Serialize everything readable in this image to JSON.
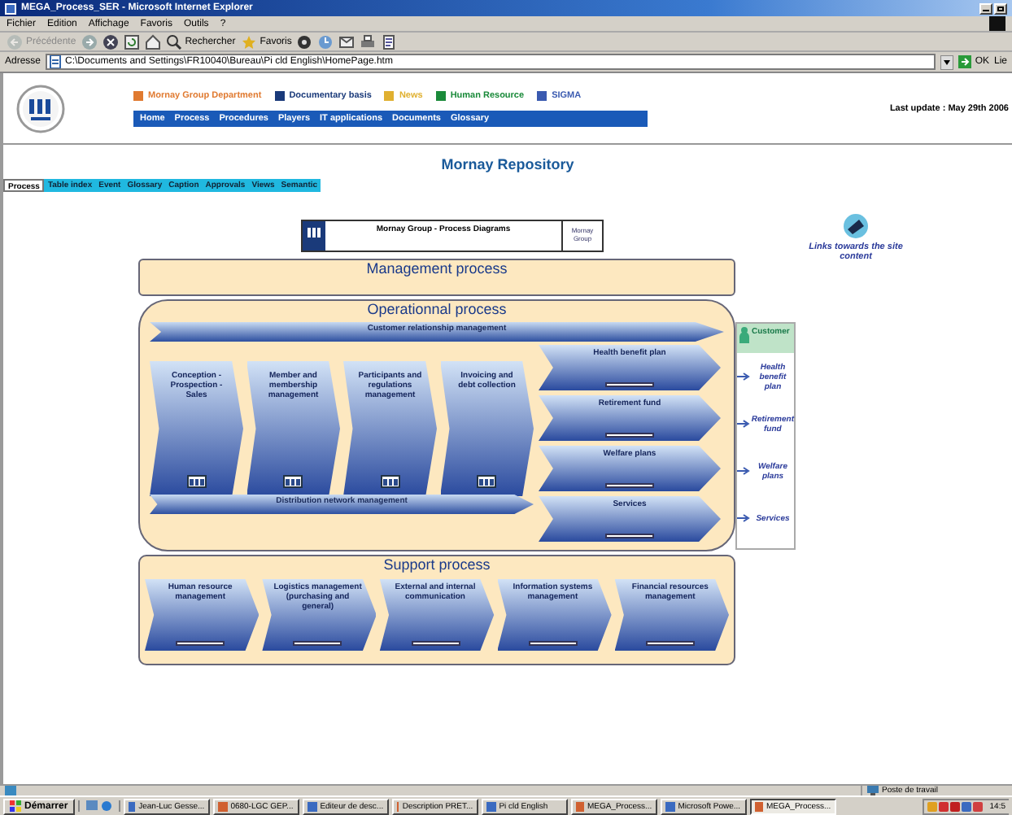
{
  "window": {
    "title": "MEGA_Process_SER - Microsoft Internet Explorer"
  },
  "menu": [
    "Fichier",
    "Edition",
    "Affichage",
    "Favoris",
    "Outils",
    "?"
  ],
  "toolbar": [
    {
      "kind": "back",
      "label": "Précédente",
      "disabled": true
    },
    {
      "kind": "forward",
      "disabled": false
    },
    {
      "kind": "stop",
      "disabled": false
    },
    {
      "kind": "refresh",
      "disabled": false
    },
    {
      "kind": "home",
      "disabled": false
    },
    {
      "kind": "search",
      "label": "Rechercher",
      "disabled": false
    },
    {
      "kind": "favorites",
      "label": "Favoris",
      "disabled": false
    },
    {
      "kind": "media",
      "disabled": false
    },
    {
      "kind": "history",
      "disabled": false
    },
    {
      "kind": "mail",
      "disabled": false
    },
    {
      "kind": "print",
      "disabled": false
    },
    {
      "kind": "edit",
      "disabled": false
    }
  ],
  "address": {
    "label": "Adresse",
    "value": "C:\\Documents and Settings\\FR10040\\Bureau\\Pi cld English\\HomePage.htm",
    "go": "OK",
    "links": "Lie"
  },
  "site_links": [
    {
      "label": "Mornay Group Department",
      "color": "#e07a30"
    },
    {
      "label": "Documentary basis",
      "color": "#1a3a7a"
    },
    {
      "label": "News",
      "color": "#e0b030"
    },
    {
      "label": "Human Resource",
      "color": "#1a8a3a"
    },
    {
      "label": "SIGMA",
      "color": "#3a5ab0"
    }
  ],
  "nav": [
    "Home",
    "Process",
    "Procedures",
    "Players",
    "IT applications",
    "Documents",
    "Glossary"
  ],
  "last_update": "Last update : May 29th 2006",
  "page_title": "Mornay Repository",
  "tabs": [
    {
      "label": "Process",
      "selected": true
    },
    {
      "label": "Table index",
      "selected": false
    },
    {
      "label": "Event",
      "selected": false
    },
    {
      "label": "Glossary",
      "selected": false
    },
    {
      "label": "Caption",
      "selected": false
    },
    {
      "label": "Approvals",
      "selected": false
    },
    {
      "label": "Views",
      "selected": false
    },
    {
      "label": "Semantic",
      "selected": false
    }
  ],
  "diagram": {
    "header": {
      "title": "Mornay Group - Process Diagrams",
      "caption": "Mornay Group"
    },
    "management": {
      "title": "Management process"
    },
    "operational": {
      "title": "Operationnal process",
      "top_flow": "Customer relationship management",
      "steps": [
        "Conception - Prospection - Sales",
        "Member and membership management",
        "Participants and regulations management",
        "Invoicing and debt collection"
      ],
      "bottom_flow": "Distribution network management",
      "products": [
        "Health benefit plan",
        "Retirement fund",
        "Welfare plans",
        "Services"
      ]
    },
    "customer": {
      "title": "Customer",
      "items": [
        "Health benefit plan",
        "Retirement fund",
        "Welfare plans",
        "Services"
      ]
    },
    "support": {
      "title": "Support process",
      "steps": [
        "Human resource management",
        "Logistics management (purchasing and general)",
        "External and internal communication",
        "Information systems management",
        "Financial resources management"
      ]
    }
  },
  "links_panel": {
    "text": "Links towards the site content"
  },
  "status_bar": {
    "zone": "Poste de travail"
  },
  "taskbar": {
    "start": "Démarrer",
    "items": [
      {
        "label": "Jean-Luc Gesse...",
        "selected": false
      },
      {
        "label": "0680-LGC GEP...",
        "selected": false
      },
      {
        "label": "Editeur de desc...",
        "selected": false
      },
      {
        "label": "Description PRET...",
        "selected": false
      },
      {
        "label": "Pi cld English",
        "selected": false
      },
      {
        "label": "MEGA_Process...",
        "selected": false
      },
      {
        "label": "Microsoft Powe...",
        "selected": false
      },
      {
        "label": "MEGA_Process...",
        "selected": true
      }
    ],
    "clock": "14:5"
  }
}
